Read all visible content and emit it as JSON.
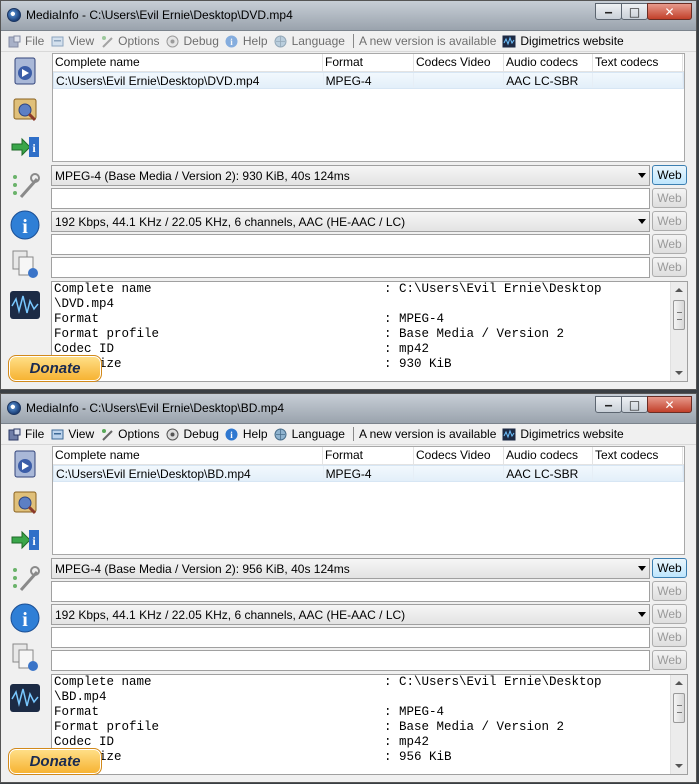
{
  "windows": [
    {
      "title": "MediaInfo - C:\\Users\\Evil Ernie\\Desktop\\DVD.mp4",
      "menu": {
        "file": "File",
        "view": "View",
        "options": "Options",
        "debug": "Debug",
        "help": "Help",
        "language": "Language",
        "notice": "A new version is available",
        "site": "Digimetrics website"
      },
      "columns": [
        "Complete name",
        "Format",
        "Codecs Video",
        "Audio codecs",
        "Text codecs"
      ],
      "row": [
        "C:\\Users\\Evil Ernie\\Desktop\\DVD.mp4",
        "MPEG-4",
        "",
        "AAC LC-SBR",
        ""
      ],
      "general_combo": "MPEG-4 (Base Media / Version 2): 930 KiB, 40s 124ms",
      "audio_combo": "192 Kbps, 44.1 KHz / 22.05 KHz, 6 channels, AAC (HE-AAC / LC)",
      "web_label": "Web",
      "text_lines": [
        {
          "k": "Complete name",
          "v": ": C:\\Users\\Evil Ernie\\Desktop"
        },
        {
          "k": "\\DVD.mp4",
          "v": ""
        },
        {
          "k": "Format",
          "v": ": MPEG-4"
        },
        {
          "k": "Format profile",
          "v": ": Base Media / Version 2"
        },
        {
          "k": "Codec ID",
          "v": ": mp42"
        },
        {
          "k": "File size",
          "v": ": 930 KiB"
        }
      ],
      "donate": "Donate"
    },
    {
      "title": "MediaInfo - C:\\Users\\Evil Ernie\\Desktop\\BD.mp4",
      "menu": {
        "file": "File",
        "view": "View",
        "options": "Options",
        "debug": "Debug",
        "help": "Help",
        "language": "Language",
        "notice": "A new version is available",
        "site": "Digimetrics website"
      },
      "columns": [
        "Complete name",
        "Format",
        "Codecs Video",
        "Audio codecs",
        "Text codecs"
      ],
      "row": [
        "C:\\Users\\Evil Ernie\\Desktop\\BD.mp4",
        "MPEG-4",
        "",
        "AAC LC-SBR",
        ""
      ],
      "general_combo": "MPEG-4 (Base Media / Version 2): 956 KiB, 40s 124ms",
      "audio_combo": "192 Kbps, 44.1 KHz / 22.05 KHz, 6 channels, AAC (HE-AAC / LC)",
      "web_label": "Web",
      "text_lines": [
        {
          "k": "Complete name",
          "v": ": C:\\Users\\Evil Ernie\\Desktop"
        },
        {
          "k": "\\BD.mp4",
          "v": ""
        },
        {
          "k": "Format",
          "v": ": MPEG-4"
        },
        {
          "k": "Format profile",
          "v": ": Base Media / Version 2"
        },
        {
          "k": "Codec ID",
          "v": ": mp42"
        },
        {
          "k": "File size",
          "v": ": 956 KiB"
        }
      ],
      "donate": "Donate"
    }
  ]
}
